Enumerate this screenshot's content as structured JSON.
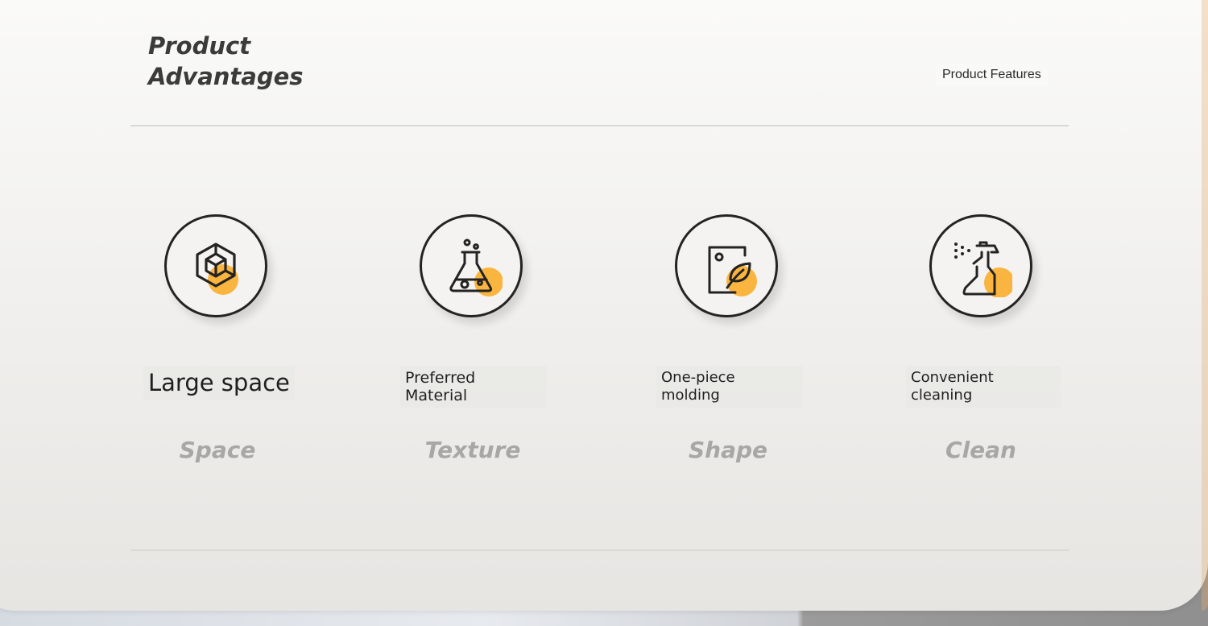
{
  "header": {
    "title_line1": "Product",
    "title_line2": "Advantages",
    "features_label": "Product Features"
  },
  "features": [
    {
      "label": "Large space",
      "sub": "Space",
      "icon": "cube-icon"
    },
    {
      "label": "Preferred Material",
      "sub": "Texture",
      "icon": "flask-icon"
    },
    {
      "label_line1": "One-piece",
      "label_line2": "molding",
      "sub": "Shape",
      "icon": "leaf-panel-icon"
    },
    {
      "label_line1": "Convenient",
      "label_line2": "cleaning",
      "sub": "Clean",
      "icon": "spray-bottle-icon"
    }
  ],
  "colors": {
    "accent": "#f9b53f",
    "stroke": "#232323",
    "sub_text": "#a8a7a5"
  }
}
